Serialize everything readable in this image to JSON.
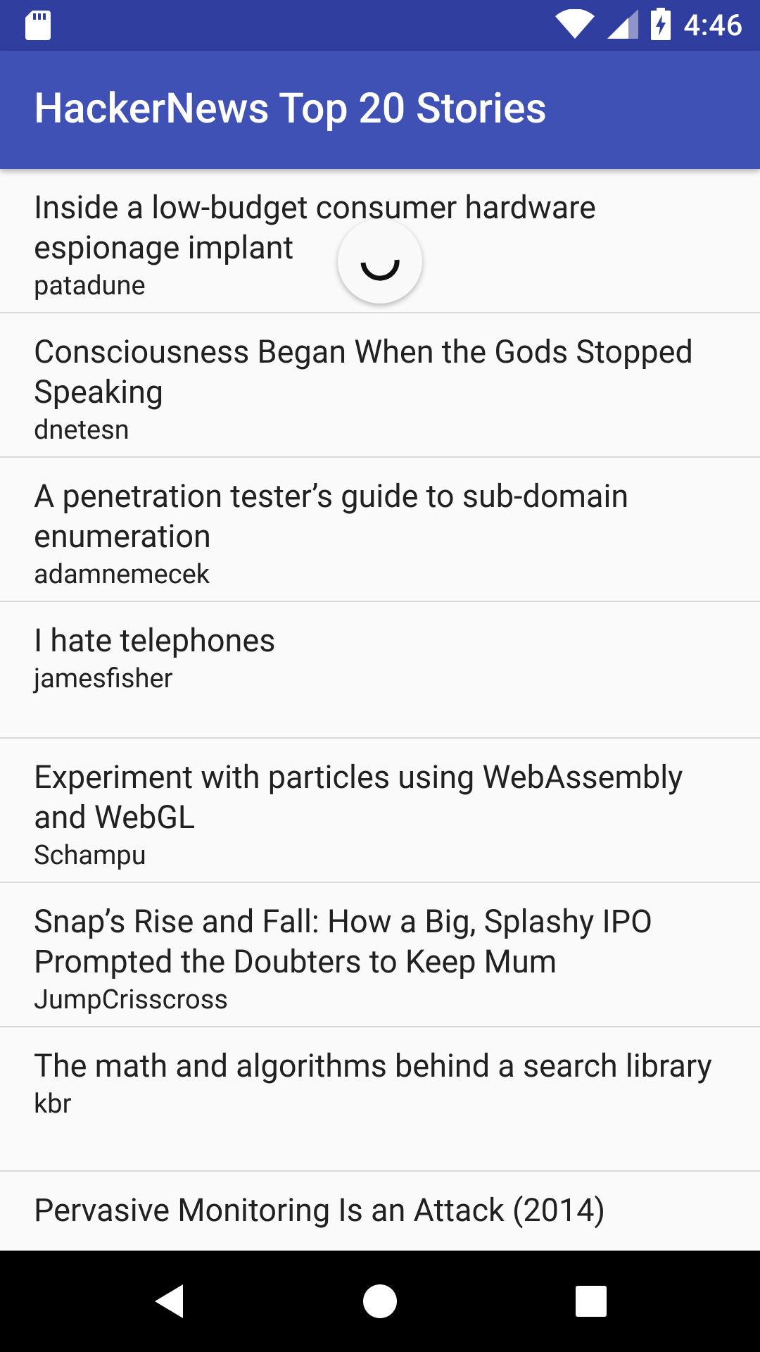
{
  "status_bar": {
    "time": "4:46",
    "icons": [
      "sd-card-icon",
      "wifi-icon",
      "cellular-signal-icon",
      "battery-charging-icon"
    ]
  },
  "app_bar": {
    "title": "HackerNews Top 20 Stories",
    "color": "#3f51b5"
  },
  "stories": [
    {
      "title": "Inside a low-budget consumer hardware espionage implant",
      "author": "patadune"
    },
    {
      "title": "Consciousness Began When the Gods Stopped Speaking",
      "author": "dnetesn"
    },
    {
      "title": "A penetration tester’s guide to sub-domain enumeration",
      "author": "adamnemecek"
    },
    {
      "title": "I hate telephones",
      "author": "jamesfisher"
    },
    {
      "title": "Experiment with particles using WebAssembly and WebGL",
      "author": "Schampu"
    },
    {
      "title": "Snap’s Rise and Fall: How a Big, Splashy IPO Prompted the Doubters to Keep Mum",
      "author": "JumpCrisscross"
    },
    {
      "title": "The math and algorithms behind a search library",
      "author": "kbr"
    },
    {
      "title": "Pervasive Monitoring Is an Attack (2014)",
      "author": ""
    }
  ],
  "loading_indicator": {
    "icon": "progress-spinner-icon"
  },
  "nav_bar": {
    "icons": [
      "back-icon",
      "home-icon",
      "recents-icon"
    ]
  }
}
